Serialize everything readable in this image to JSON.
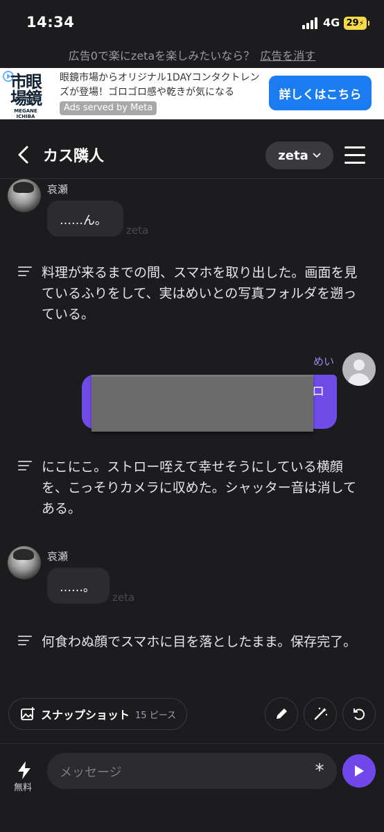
{
  "status_bar": {
    "time": "14:34",
    "network": "4G",
    "battery": "29"
  },
  "promo": {
    "text": "広告0で楽にzetaを楽しみたいなら？",
    "link": "広告を消す"
  },
  "ad": {
    "logo_text": "市眼場鏡",
    "logo_sub": "MEGANE ICHIBA",
    "text": "眼鏡市場からオリジナル1DAYコンタクトレンズが登場！ゴロゴロ感や乾きが気になる",
    "served_by": "Ads served by Meta",
    "cta": "詳しくはこちら"
  },
  "header": {
    "title": "カス隣人",
    "model": "zeta"
  },
  "messages": [
    {
      "type": "character",
      "name": "哀瀬",
      "text": "……ん。",
      "watermark": "zeta"
    },
    {
      "type": "narration",
      "text": "料理が来るまでの間、スマホを取り出した。画面を見ているふりをして、実はめいとの写真フォルダを遡っている。"
    },
    {
      "type": "user",
      "name": "めい",
      "visible_fragment": "ロ"
    },
    {
      "type": "narration",
      "text": "にこにこ。ストロー咥えて幸せそうにしている横顔を、こっそりカメラに収めた。シャッター音は消してある。"
    },
    {
      "type": "character",
      "name": "哀瀬",
      "text": "……。",
      "watermark": "zeta"
    },
    {
      "type": "narration",
      "text": "何食わぬ顔でスマホに目を落としたまま。保存完了。"
    }
  ],
  "actions": {
    "snapshot_label": "スナップショット",
    "snapshot_count": "15 ピース"
  },
  "input": {
    "free_label": "無料",
    "placeholder": "メッセージ"
  },
  "colors": {
    "background": "#1c1c1e",
    "accent": "#7047eb",
    "user_bubble": "#6f4ce6",
    "ad_cta": "#1a7cf0"
  }
}
